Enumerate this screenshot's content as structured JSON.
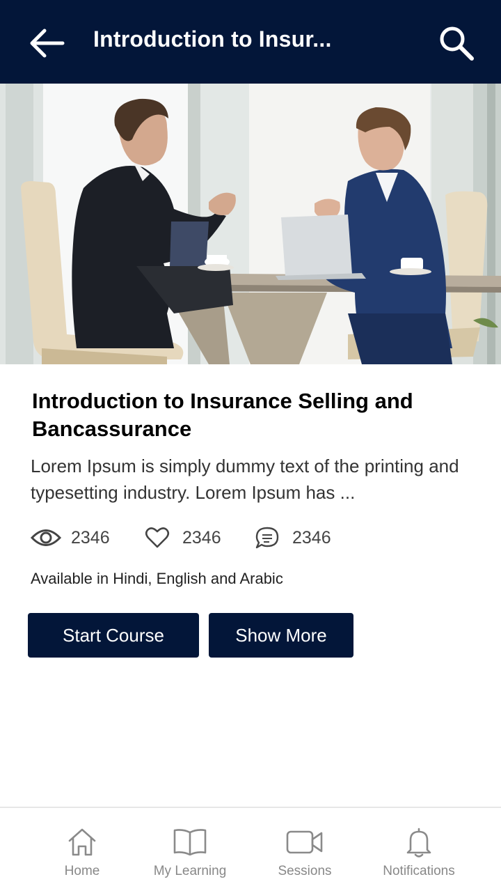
{
  "header": {
    "title": "Introduction to Insur...",
    "back_icon": "arrow-left-icon",
    "search_icon": "search-icon",
    "bg_color": "#031639"
  },
  "hero": {
    "icon": "business-meeting-photo"
  },
  "course": {
    "title": "Introduction to Insurance Selling and Bancassurance",
    "description": "Lorem Ipsum is simply dummy text of the printing and typesetting industry. Lorem Ipsum has ...",
    "stats": {
      "views": "2346",
      "likes": "2346",
      "comments": "2346"
    },
    "languages": "Available in Hindi, English and Arabic"
  },
  "actions": {
    "start_label": "Start Course",
    "more_label": "Show More"
  },
  "nav": {
    "items": [
      {
        "label": "Home",
        "icon": "home-icon"
      },
      {
        "label": "My Learning",
        "icon": "book-icon"
      },
      {
        "label": "Sessions",
        "icon": "video-camera-icon"
      },
      {
        "label": "Notifications",
        "icon": "bell-icon"
      }
    ]
  }
}
